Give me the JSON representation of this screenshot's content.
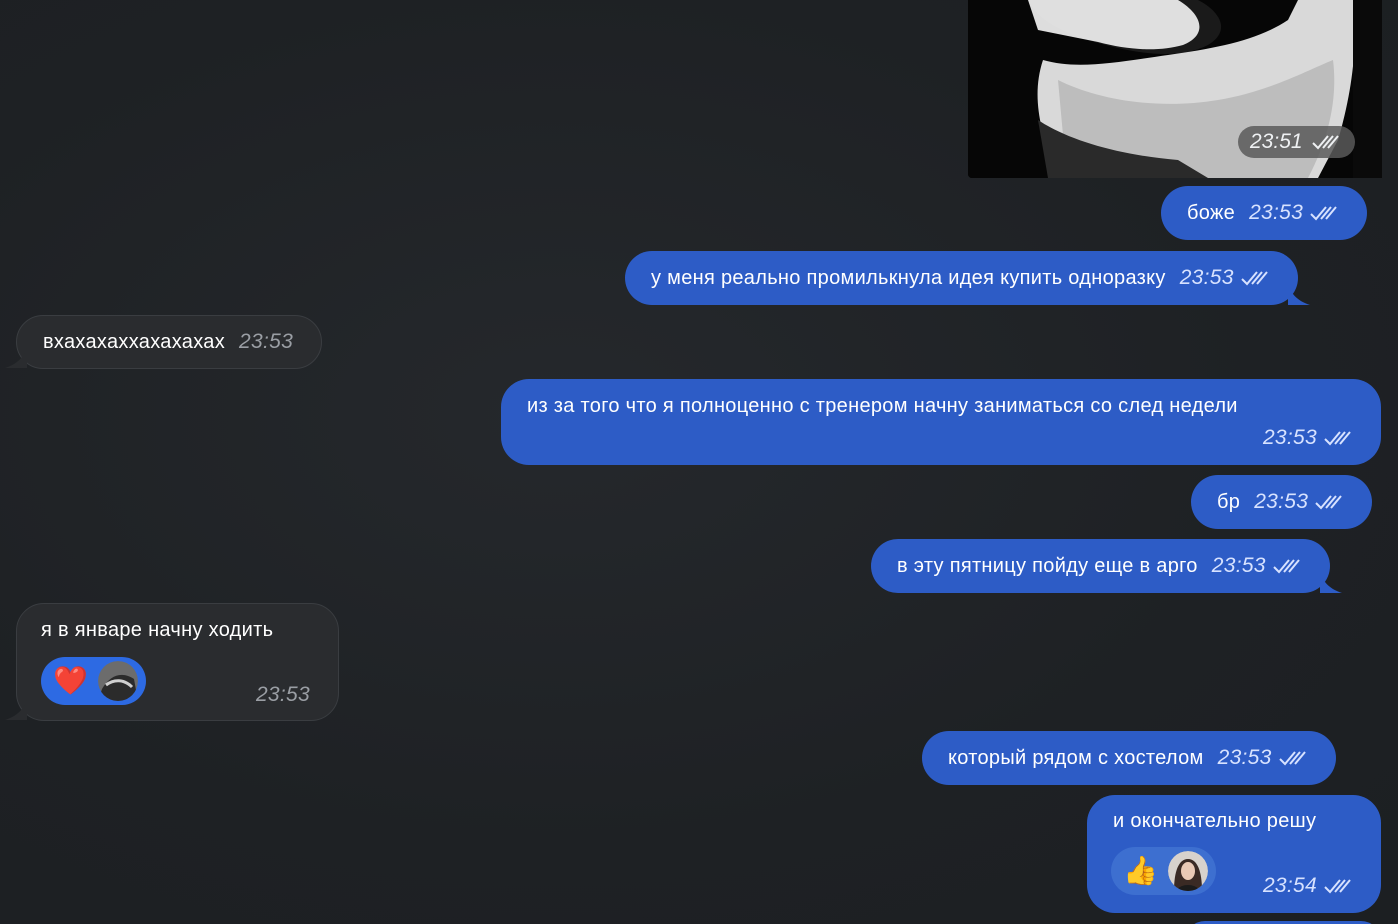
{
  "media": {
    "time": "23:51"
  },
  "messages": [
    {
      "id": "m1",
      "text": "боже",
      "time": "23:53"
    },
    {
      "id": "m2",
      "text": "у меня реально промилькнула идея купить одноразку",
      "time": "23:53"
    },
    {
      "id": "m3",
      "text": "вхахахаххахахахах",
      "time": "23:53"
    },
    {
      "id": "m4",
      "text": "из за того что я полноценно с тренером начну заниматься со след недели",
      "time": "23:53"
    },
    {
      "id": "m5",
      "text": "бр",
      "time": "23:53"
    },
    {
      "id": "m6",
      "text": "в эту пятницу пойду еще в арго",
      "time": "23:53"
    },
    {
      "id": "m7",
      "text": "я в январе начну ходить",
      "time": "23:53",
      "reaction": "❤️"
    },
    {
      "id": "m8",
      "text": "который рядом с хостелом",
      "time": "23:53"
    },
    {
      "id": "m9",
      "text": "и окончательно решу",
      "time": "23:54",
      "reaction": "👍"
    }
  ],
  "colors": {
    "outgoing_bubble": "#2d5cc6",
    "incoming_bubble": "#2a2c2f",
    "background": "#202326"
  },
  "icons": {
    "read_status": "double-check-icon",
    "reaction_avatar": "avatar"
  }
}
